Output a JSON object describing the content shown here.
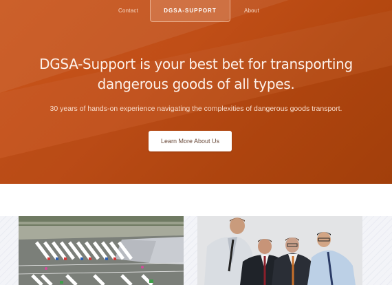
{
  "nav": {
    "contact_label": "Contact",
    "brand_label": "DGSA-SUPPORT",
    "about_label": "About"
  },
  "hero": {
    "title_line1": "DGSA-Support is your best bet for transporting",
    "title_line2": "dangerous goods of all types.",
    "subtitle": "30 years of hands-on experience navigating the complexities of dangerous goods transport.",
    "cta_label": "Learn More About Us"
  },
  "cards": [
    {
      "icon": "trucks-aerial-photo"
    },
    {
      "icon": "business-team-photo"
    }
  ],
  "colors": {
    "hero_primary": "#c04e17",
    "hero_dark": "#a8420c",
    "cta_bg": "#ffffff",
    "text_light": "#fdf1ea"
  }
}
